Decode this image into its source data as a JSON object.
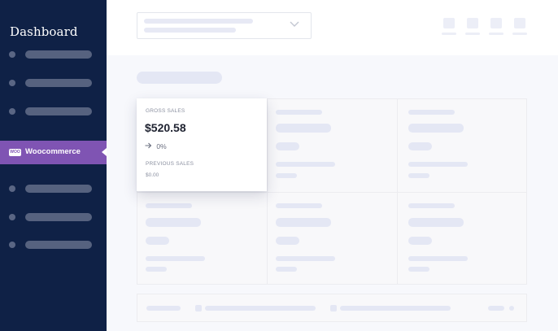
{
  "sidebar": {
    "title": "Dashboard",
    "active_item": {
      "label": "Woocommerce",
      "logo_text": "WOO",
      "color": "#7f54b3"
    },
    "background": "#0f2146"
  },
  "card": {
    "label": "GROSS SALES",
    "value": "$520.58",
    "trend_icon": "arrow-right-icon",
    "trend_value": "0%",
    "previous_label": "PREVIOUS SALES",
    "previous_value": "$0.00"
  },
  "header": {
    "select_icon": "chevron-down-icon"
  }
}
